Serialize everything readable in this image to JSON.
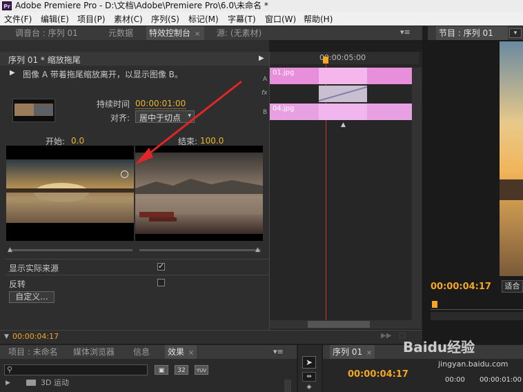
{
  "window": {
    "app_icon": "Pr",
    "title": "Adobe Premiere Pro - D:\\文档\\Adobe\\Premiere Pro\\6.0\\未命名 *"
  },
  "menu": [
    "文件(F)",
    "编辑(E)",
    "项目(P)",
    "素材(C)",
    "序列(S)",
    "标记(M)",
    "字幕(T)",
    "窗口(W)",
    "帮助(H)"
  ],
  "top_tabs": {
    "mixer": "调音台 : 序列 01",
    "metadata": "元数据",
    "effect_controls": "特效控制台",
    "source": "源: (无素材)",
    "program": "节目 : 序列 01"
  },
  "effect_controls": {
    "header": "序列 01 * 缩放拖尾",
    "description": "图像 A 带着拖尾缩放离开，以显示图像 B。",
    "duration_label": "持续时间",
    "duration_value": "00:00:01:00",
    "align_label": "对齐:",
    "align_value": "居中于切点",
    "start_label": "开始:",
    "start_value": "0.0",
    "end_label": "结束:",
    "end_value": "100.0",
    "show_actual_label": "显示实际来源",
    "reverse_label": "反转",
    "custom_button": "自定义...",
    "timecode": "00:00:04:17",
    "show_actual_checked": true,
    "reverse_checked": false
  },
  "mini_timeline": {
    "ruler_time": "00:00:05:00",
    "track_a_label": "A",
    "track_b_label": "B",
    "fx_label": "fx",
    "clip_a": "01.jpg",
    "clip_b": "04.jpg"
  },
  "program": {
    "timecode": "00:00:04:17",
    "fit": "适合"
  },
  "bottom_tabs": {
    "project": "项目 : 未命名",
    "media_browser": "媒体浏览器",
    "info": "信息",
    "effects": "效果",
    "sequence": "序列 01"
  },
  "effects_panel": {
    "search_placeholder": "",
    "badge_32": "32",
    "badge_yuv": "YUV",
    "folder_item": "3D 运动"
  },
  "sequence_panel": {
    "timecode": "00:00:04:17",
    "ruler_1": "00:00",
    "ruler_2": "00:00:01:00"
  },
  "watermark": {
    "brand": "Baidu经验",
    "url": "jingyan.baidu.com"
  }
}
